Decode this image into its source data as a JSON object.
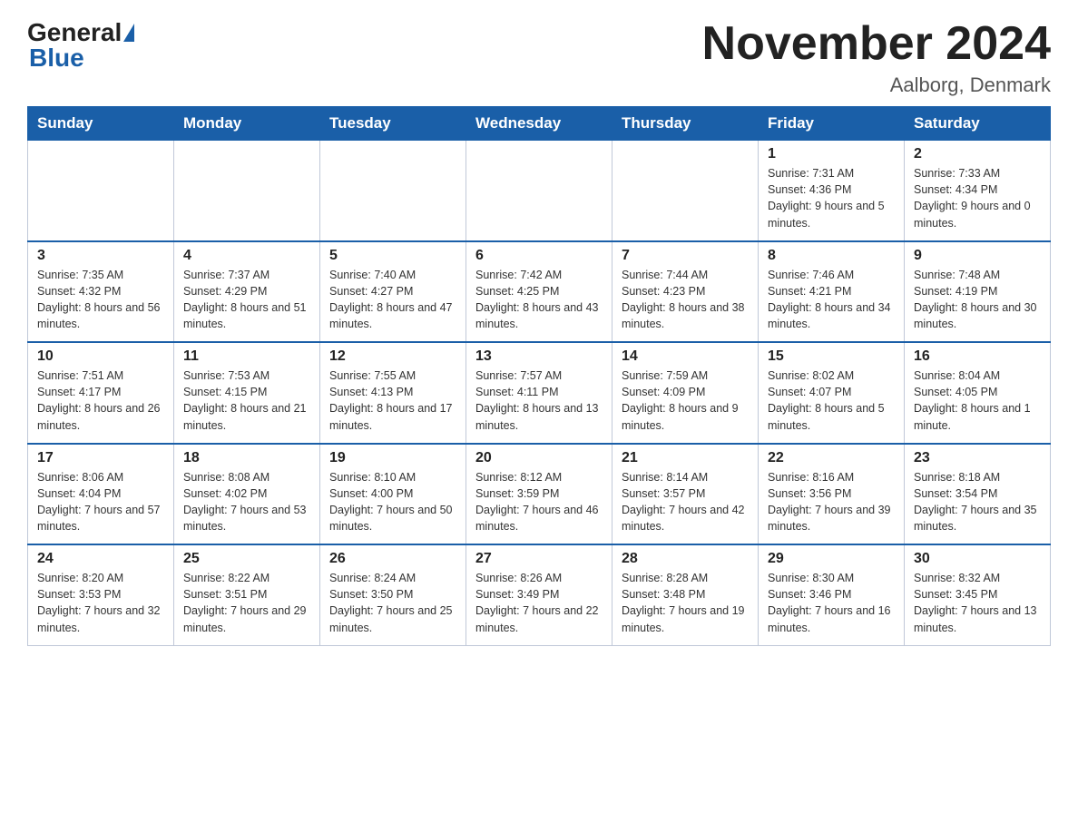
{
  "header": {
    "logo": {
      "general": "General",
      "blue": "Blue"
    },
    "title": "November 2024",
    "location": "Aalborg, Denmark"
  },
  "weekdays": [
    "Sunday",
    "Monday",
    "Tuesday",
    "Wednesday",
    "Thursday",
    "Friday",
    "Saturday"
  ],
  "weeks": [
    [
      {
        "day": null,
        "info": null
      },
      {
        "day": null,
        "info": null
      },
      {
        "day": null,
        "info": null
      },
      {
        "day": null,
        "info": null
      },
      {
        "day": null,
        "info": null
      },
      {
        "day": "1",
        "info": "Sunrise: 7:31 AM\nSunset: 4:36 PM\nDaylight: 9 hours and 5 minutes."
      },
      {
        "day": "2",
        "info": "Sunrise: 7:33 AM\nSunset: 4:34 PM\nDaylight: 9 hours and 0 minutes."
      }
    ],
    [
      {
        "day": "3",
        "info": "Sunrise: 7:35 AM\nSunset: 4:32 PM\nDaylight: 8 hours and 56 minutes."
      },
      {
        "day": "4",
        "info": "Sunrise: 7:37 AM\nSunset: 4:29 PM\nDaylight: 8 hours and 51 minutes."
      },
      {
        "day": "5",
        "info": "Sunrise: 7:40 AM\nSunset: 4:27 PM\nDaylight: 8 hours and 47 minutes."
      },
      {
        "day": "6",
        "info": "Sunrise: 7:42 AM\nSunset: 4:25 PM\nDaylight: 8 hours and 43 minutes."
      },
      {
        "day": "7",
        "info": "Sunrise: 7:44 AM\nSunset: 4:23 PM\nDaylight: 8 hours and 38 minutes."
      },
      {
        "day": "8",
        "info": "Sunrise: 7:46 AM\nSunset: 4:21 PM\nDaylight: 8 hours and 34 minutes."
      },
      {
        "day": "9",
        "info": "Sunrise: 7:48 AM\nSunset: 4:19 PM\nDaylight: 8 hours and 30 minutes."
      }
    ],
    [
      {
        "day": "10",
        "info": "Sunrise: 7:51 AM\nSunset: 4:17 PM\nDaylight: 8 hours and 26 minutes."
      },
      {
        "day": "11",
        "info": "Sunrise: 7:53 AM\nSunset: 4:15 PM\nDaylight: 8 hours and 21 minutes."
      },
      {
        "day": "12",
        "info": "Sunrise: 7:55 AM\nSunset: 4:13 PM\nDaylight: 8 hours and 17 minutes."
      },
      {
        "day": "13",
        "info": "Sunrise: 7:57 AM\nSunset: 4:11 PM\nDaylight: 8 hours and 13 minutes."
      },
      {
        "day": "14",
        "info": "Sunrise: 7:59 AM\nSunset: 4:09 PM\nDaylight: 8 hours and 9 minutes."
      },
      {
        "day": "15",
        "info": "Sunrise: 8:02 AM\nSunset: 4:07 PM\nDaylight: 8 hours and 5 minutes."
      },
      {
        "day": "16",
        "info": "Sunrise: 8:04 AM\nSunset: 4:05 PM\nDaylight: 8 hours and 1 minute."
      }
    ],
    [
      {
        "day": "17",
        "info": "Sunrise: 8:06 AM\nSunset: 4:04 PM\nDaylight: 7 hours and 57 minutes."
      },
      {
        "day": "18",
        "info": "Sunrise: 8:08 AM\nSunset: 4:02 PM\nDaylight: 7 hours and 53 minutes."
      },
      {
        "day": "19",
        "info": "Sunrise: 8:10 AM\nSunset: 4:00 PM\nDaylight: 7 hours and 50 minutes."
      },
      {
        "day": "20",
        "info": "Sunrise: 8:12 AM\nSunset: 3:59 PM\nDaylight: 7 hours and 46 minutes."
      },
      {
        "day": "21",
        "info": "Sunrise: 8:14 AM\nSunset: 3:57 PM\nDaylight: 7 hours and 42 minutes."
      },
      {
        "day": "22",
        "info": "Sunrise: 8:16 AM\nSunset: 3:56 PM\nDaylight: 7 hours and 39 minutes."
      },
      {
        "day": "23",
        "info": "Sunrise: 8:18 AM\nSunset: 3:54 PM\nDaylight: 7 hours and 35 minutes."
      }
    ],
    [
      {
        "day": "24",
        "info": "Sunrise: 8:20 AM\nSunset: 3:53 PM\nDaylight: 7 hours and 32 minutes."
      },
      {
        "day": "25",
        "info": "Sunrise: 8:22 AM\nSunset: 3:51 PM\nDaylight: 7 hours and 29 minutes."
      },
      {
        "day": "26",
        "info": "Sunrise: 8:24 AM\nSunset: 3:50 PM\nDaylight: 7 hours and 25 minutes."
      },
      {
        "day": "27",
        "info": "Sunrise: 8:26 AM\nSunset: 3:49 PM\nDaylight: 7 hours and 22 minutes."
      },
      {
        "day": "28",
        "info": "Sunrise: 8:28 AM\nSunset: 3:48 PM\nDaylight: 7 hours and 19 minutes."
      },
      {
        "day": "29",
        "info": "Sunrise: 8:30 AM\nSunset: 3:46 PM\nDaylight: 7 hours and 16 minutes."
      },
      {
        "day": "30",
        "info": "Sunrise: 8:32 AM\nSunset: 3:45 PM\nDaylight: 7 hours and 13 minutes."
      }
    ]
  ]
}
